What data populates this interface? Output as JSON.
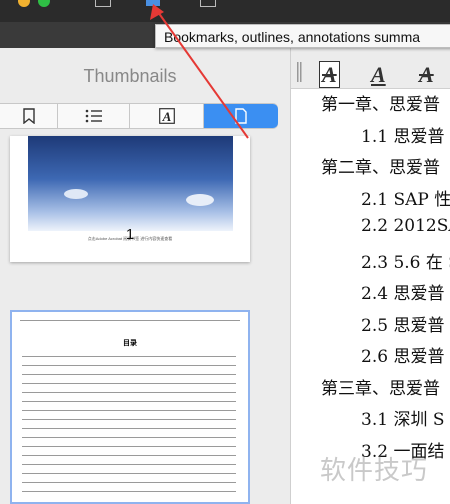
{
  "tooltip": {
    "text": "Bookmarks, outlines, annotations summa"
  },
  "sidebar": {
    "title": "Thumbnails",
    "segments": [
      {
        "name": "bookmark",
        "icon": "bookmark-icon"
      },
      {
        "name": "outline",
        "icon": "list-icon"
      },
      {
        "name": "annotation",
        "icon": "annotation-icon"
      },
      {
        "name": "thumbnails",
        "icon": "page-icon",
        "selected": true
      }
    ],
    "thumb1": {
      "caption": "点击Adobe Acrobat 阅读书签 进行内容快速查看",
      "page_number": "1"
    },
    "thumb2": {
      "title": "目录"
    }
  },
  "toolbar": {
    "tool1": "A",
    "tool2": "A",
    "tool3": "A"
  },
  "toc": [
    {
      "text": "第一章、思爱普",
      "indent": 0
    },
    {
      "text": "1.1 思爱普",
      "indent": 1
    },
    {
      "text": "第二章、思爱普",
      "indent": 0
    },
    {
      "text": "2.1 SAP 性",
      "indent": 1
    },
    {
      "text": "2.2 2012SA",
      "indent": 1
    },
    {
      "text": "2.3 5.6 在 S",
      "indent": 1
    },
    {
      "text": "2.4 思爱普",
      "indent": 1
    },
    {
      "text": "2.5 思爱普",
      "indent": 1
    },
    {
      "text": "2.6 思爱普",
      "indent": 1
    },
    {
      "text": "第三章、思爱普",
      "indent": 0
    },
    {
      "text": "3.1 深圳 S",
      "indent": 1
    },
    {
      "text": "3.2 一面结",
      "indent": 1
    }
  ],
  "watermark": "软件技巧",
  "colors": {
    "selected_segment": "#3b8ff2",
    "arrow": "#e53935"
  }
}
